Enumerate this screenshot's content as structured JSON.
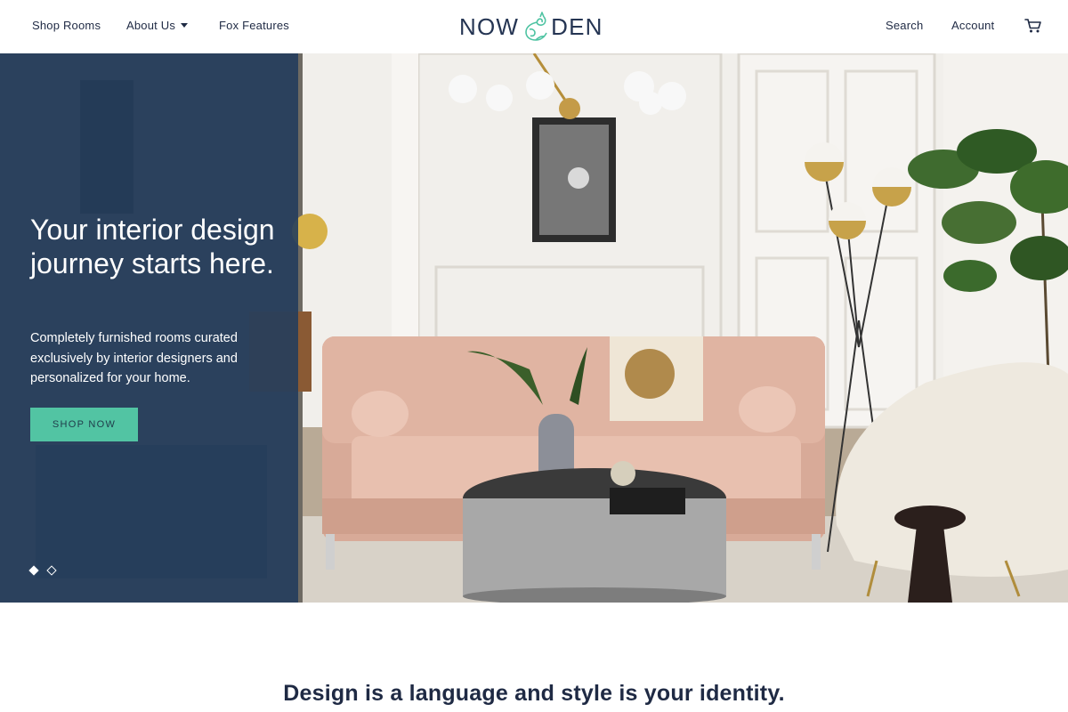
{
  "header": {
    "nav_left": {
      "shop_rooms": "Shop Rooms",
      "about_us": "About Us",
      "fox_features": "Fox Features"
    },
    "logo": {
      "left": "NOW",
      "right": "DEN",
      "icon": "fox-ampersand-icon"
    },
    "nav_right": {
      "search": "Search",
      "account": "Account",
      "cart_icon": "shopping-cart-icon"
    }
  },
  "hero": {
    "title": "Your interior design journey starts here.",
    "subtitle": "Completely furnished rooms curated exclusively by interior designers and personalized for your home.",
    "cta_label": "SHOP NOW",
    "slides": {
      "count": 2,
      "active": 1
    }
  },
  "tagline": "Design is a language and style is your identity.",
  "colors": {
    "brand_navy": "#243d5c",
    "accent_teal": "#52c4a3",
    "text_dark": "#1f2a44"
  }
}
